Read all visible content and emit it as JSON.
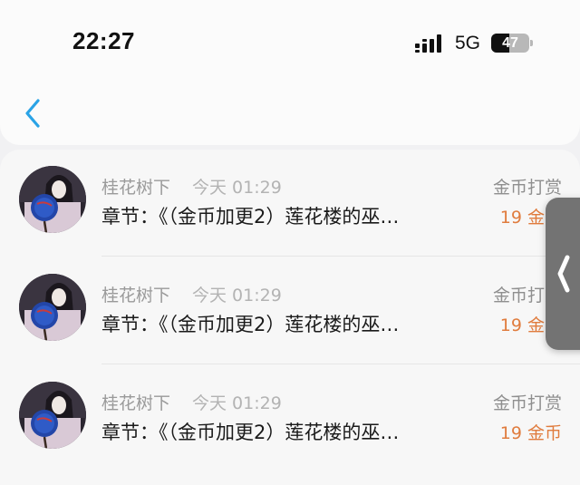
{
  "status_bar": {
    "time": "22:27",
    "network": "5G",
    "battery": "47",
    "battery_level": 0.47,
    "signal_icon": "signal-bars-icon",
    "battery_icon": "battery-icon"
  },
  "nav": {
    "back_icon": "chevron-left-icon",
    "accent_color": "#2aa3e6"
  },
  "rows": [
    {
      "user": "桂花树下",
      "time": "今天 01:29",
      "chapter": "章节：《（金币加更2）莲花楼的巫…",
      "reward_type": "金币打赏",
      "reward_amount": "19 金币"
    },
    {
      "user": "桂花树下",
      "time": "今天 01:29",
      "chapter": "章节：《（金币加更2）莲花楼的巫…",
      "reward_type": "金币打赏",
      "reward_amount": "19 金币"
    },
    {
      "user": "桂花树下",
      "time": "今天 01:29",
      "chapter": "章节：《（金币加更2）莲花楼的巫…",
      "reward_type": "金币打赏",
      "reward_amount": "19 金币"
    }
  ],
  "side_handle": {
    "icon": "chevron-left-icon"
  },
  "colors": {
    "reward": "#e07c3e",
    "muted": "#9a9a9a"
  }
}
